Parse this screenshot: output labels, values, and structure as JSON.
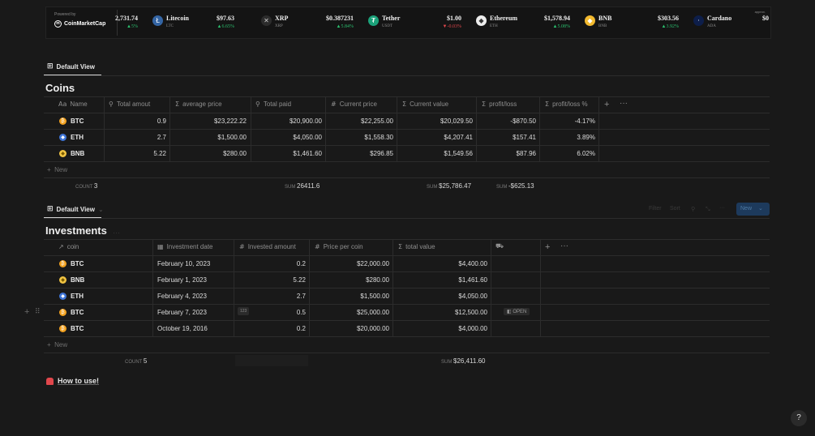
{
  "ticker": {
    "powered_by": "Powered by",
    "brand": "CoinMarketCap",
    "approx": "approx.",
    "coins": [
      {
        "name": "",
        "symbol": "",
        "price": "2,731.74",
        "change": "5%",
        "dir": "up"
      },
      {
        "name": "Litecoin",
        "symbol": "LTC",
        "price": "$97.63",
        "change": "6.65%",
        "dir": "up"
      },
      {
        "name": "XRP",
        "symbol": "XRP",
        "price": "$0.387231",
        "change": "5.84%",
        "dir": "up"
      },
      {
        "name": "Tether",
        "symbol": "USDT",
        "price": "$1.00",
        "change": "-0.03%",
        "dir": "down"
      },
      {
        "name": "Ethereum",
        "symbol": "ETH",
        "price": "$1,578.94",
        "change": "5.08%",
        "dir": "up"
      },
      {
        "name": "BNB",
        "symbol": "BNB",
        "price": "$303.56",
        "change": "3.92%",
        "dir": "up"
      },
      {
        "name": "Cardano",
        "symbol": "ADA",
        "price": "$0",
        "change": "",
        "dir": "up"
      }
    ]
  },
  "coins_view": {
    "tab_label": "Default View",
    "title": "Coins",
    "headers": [
      "Name",
      "Total amout",
      "average price",
      "Total paid",
      "Current price",
      "Current value",
      "profit/loss",
      "profit/loss %"
    ],
    "header_icons": [
      "Aa",
      "magnifier-icon",
      "sigma-icon",
      "magnifier-icon",
      "hash-icon",
      "sigma-icon",
      "sigma-icon",
      "sigma-icon"
    ],
    "rows": [
      {
        "coin": "BTC",
        "icon": "btc",
        "amount": "0.9",
        "avg": "$23,222.22",
        "paid": "$20,900.00",
        "price": "$22,255.00",
        "value": "$20,029.50",
        "pl": "-$870.50",
        "plp": "-4.17%"
      },
      {
        "coin": "ETH",
        "icon": "eth",
        "amount": "2.7",
        "avg": "$1,500.00",
        "paid": "$4,050.00",
        "price": "$1,558.30",
        "value": "$4,207.41",
        "pl": "$157.41",
        "plp": "3.89%"
      },
      {
        "coin": "BNB",
        "icon": "bnb",
        "amount": "5.22",
        "avg": "$280.00",
        "paid": "$1,461.60",
        "price": "$296.85",
        "value": "$1,549.56",
        "pl": "$87.96",
        "plp": "6.02%"
      }
    ],
    "new_label": "New",
    "footer": {
      "count_label": "COUNT",
      "count": "3",
      "sum_label": "SUM",
      "sum_paid": "26411.6",
      "sum_value": "$25,786.47",
      "sum_pl": "-$625.13"
    }
  },
  "investments_view": {
    "tab_label": "Default View",
    "title": "Investments",
    "toolbar_new": "New",
    "headers": [
      "coin",
      "Investment date",
      "Invested amount",
      "Price per coin",
      "total value"
    ],
    "rows": [
      {
        "coin": "BTC",
        "icon": "btc",
        "date": "February 10, 2023",
        "amount": "0.2",
        "price": "$22,000.00",
        "total": "$4,400.00"
      },
      {
        "coin": "BNB",
        "icon": "bnb",
        "date": "February 1, 2023",
        "amount": "5.22",
        "price": "$280.00",
        "total": "$1,461.60"
      },
      {
        "coin": "ETH",
        "icon": "eth",
        "date": "February 4, 2023",
        "amount": "2.7",
        "price": "$1,500.00",
        "total": "$4,050.00"
      },
      {
        "coin": "BTC",
        "icon": "btc",
        "date": "February 7, 2023",
        "amount": "0.5",
        "price": "$25,000.00",
        "total": "$12,500.00"
      },
      {
        "coin": "BTC",
        "icon": "btc",
        "date": "October 19, 2016",
        "amount": "0.2",
        "price": "$20,000.00",
        "total": "$4,000.00"
      }
    ],
    "open_label": "OPEN",
    "new_label": "New",
    "footer": {
      "count_label": "COUNT",
      "count": "5",
      "sum_label": "SUM",
      "sum_total": "$26,411.60"
    }
  },
  "how_to_use": "How to use!",
  "help": "?",
  "colors": {
    "background": "#191919",
    "up": "#2bbf6e",
    "down": "#e0474c",
    "btc": "#f2a11f",
    "eth": "#3e74d6",
    "bnb": "#f0c342"
  }
}
